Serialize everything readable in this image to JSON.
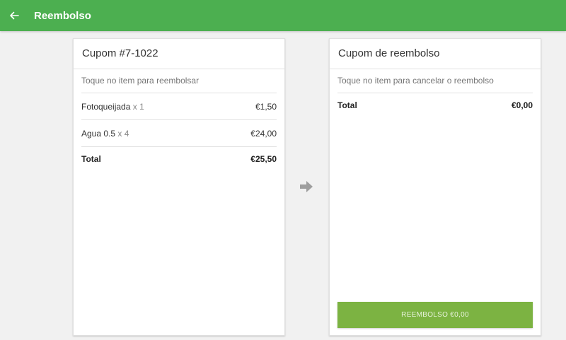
{
  "appbar": {
    "title": "Reembolso",
    "back_icon": "arrow-left-icon",
    "color": "#4caf50"
  },
  "receipt": {
    "title": "Cupom #7-1022",
    "hint": "Toque no item para reembolsar",
    "items": [
      {
        "name": "Fotoqueijada",
        "qty": "x 1",
        "price": "€1,50"
      },
      {
        "name": "Agua 0.5",
        "qty": "x 4",
        "price": "€24,00"
      }
    ],
    "total_label": "Total",
    "total_value": "€25,50"
  },
  "transfer_icon": "arrow-right-icon",
  "refund": {
    "title": "Cupom de reembolso",
    "hint": "Toque no item para cancelar o reembolso",
    "total_label": "Total",
    "total_value": "€0,00",
    "button_label": "REEMBOLSO €0,00",
    "button_color": "#7cb342"
  }
}
